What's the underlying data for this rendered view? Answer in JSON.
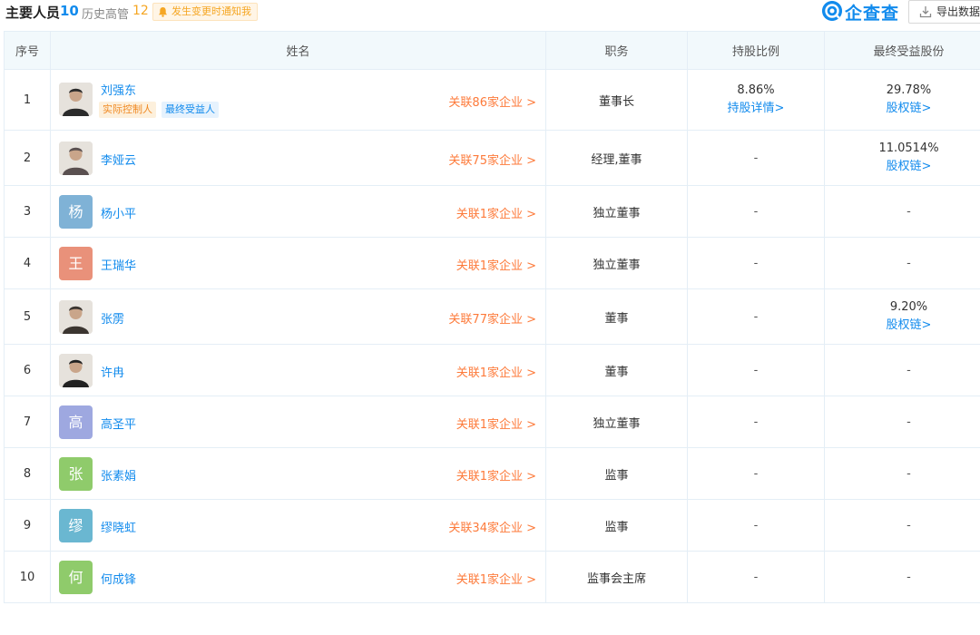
{
  "header": {
    "title": "主要人员",
    "count": "10",
    "history_label": "历史高管",
    "history_count": "12",
    "notify_label": "发生变更时通知我",
    "brand": "企查查",
    "export_label": "导出数据"
  },
  "colors": {
    "accent": "#128bed",
    "orange": "#fd7a3a",
    "header_bg": "#f2f9fc"
  },
  "table": {
    "columns": [
      "序号",
      "姓名",
      "职务",
      "持股比例",
      "最终受益股份"
    ],
    "rows": [
      {
        "index": "1",
        "name": "刘强东",
        "avatar": "photo",
        "tags": [
          "实际控制人",
          "最终受益人"
        ],
        "related": "关联86家企业 >",
        "position": "董事长",
        "share": "8.86%",
        "share_link": "持股详情>",
        "final": "29.78%",
        "final_link": "股权链>"
      },
      {
        "index": "2",
        "name": "李娅云",
        "avatar": "photo",
        "related": "关联75家企业 >",
        "position": "经理,董事",
        "share": "-",
        "final": "11.0514%",
        "final_link": "股权链>"
      },
      {
        "index": "3",
        "name": "杨小平",
        "avatar_char": "杨",
        "avatar_color": "#7fb2d6",
        "related": "关联1家企业 >",
        "position": "独立董事",
        "share": "-",
        "final": "-"
      },
      {
        "index": "4",
        "name": "王瑞华",
        "avatar_char": "王",
        "avatar_color": "#e9917a",
        "related": "关联1家企业 >",
        "position": "独立董事",
        "share": "-",
        "final": "-"
      },
      {
        "index": "5",
        "name": "张雳",
        "avatar": "photo",
        "related": "关联77家企业 >",
        "position": "董事",
        "share": "-",
        "final": "9.20%",
        "final_link": "股权链>"
      },
      {
        "index": "6",
        "name": "许冉",
        "avatar": "photo",
        "related": "关联1家企业 >",
        "position": "董事",
        "share": "-",
        "final": "-"
      },
      {
        "index": "7",
        "name": "高圣平",
        "avatar_char": "高",
        "avatar_color": "#9ea8e0",
        "related": "关联1家企业 >",
        "position": "独立董事",
        "share": "-",
        "final": "-"
      },
      {
        "index": "8",
        "name": "张素娟",
        "avatar_char": "张",
        "avatar_color": "#8fcb6b",
        "related": "关联1家企业 >",
        "position": "监事",
        "share": "-",
        "final": "-"
      },
      {
        "index": "9",
        "name": "缪晓虹",
        "avatar_char": "缪",
        "avatar_color": "#6ab7d1",
        "related": "关联34家企业 >",
        "position": "监事",
        "share": "-",
        "final": "-"
      },
      {
        "index": "10",
        "name": "何成锋",
        "avatar_char": "何",
        "avatar_color": "#8fcb6b",
        "related": "关联1家企业 >",
        "position": "监事会主席",
        "share": "-",
        "final": "-"
      }
    ]
  }
}
